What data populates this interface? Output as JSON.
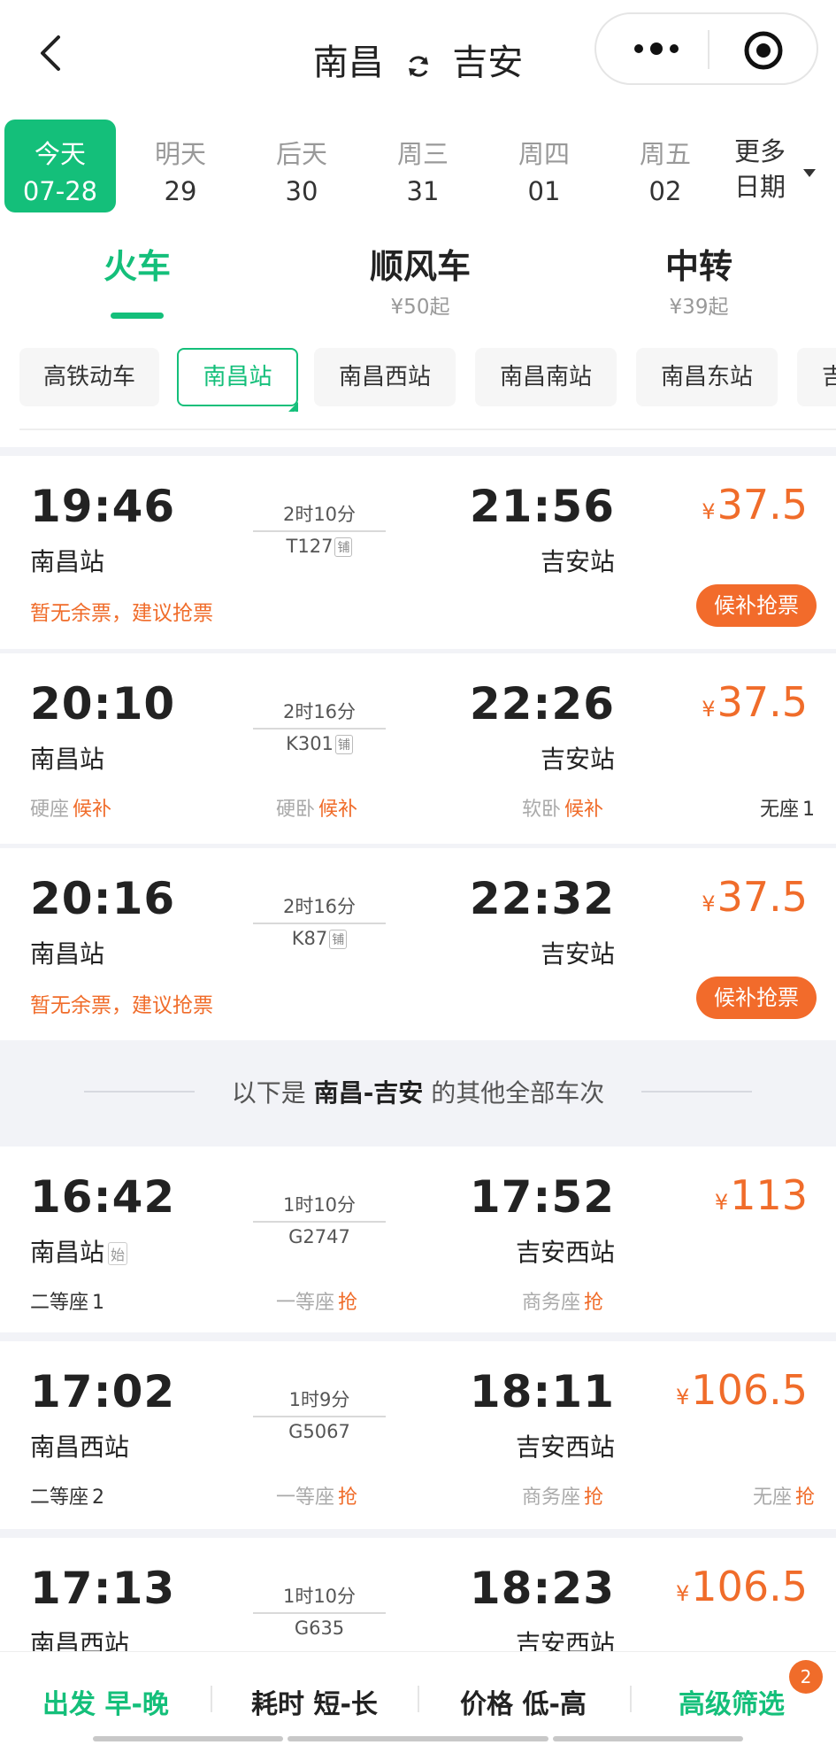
{
  "header": {
    "from": "南昌",
    "to": "吉安"
  },
  "dates": {
    "items": [
      {
        "weekday": "今天",
        "day": "07-28"
      },
      {
        "weekday": "明天",
        "day": "29"
      },
      {
        "weekday": "后天",
        "day": "30"
      },
      {
        "weekday": "周三",
        "day": "31"
      },
      {
        "weekday": "周四",
        "day": "01"
      },
      {
        "weekday": "周五",
        "day": "02"
      }
    ],
    "more_line1": "更多",
    "more_line2": "日期"
  },
  "modes": [
    {
      "label": "火车",
      "sub": ""
    },
    {
      "label": "顺风车",
      "sub": "¥50起"
    },
    {
      "label": "中转",
      "sub": "¥39起"
    }
  ],
  "chips": [
    "高铁动车",
    "南昌站",
    "南昌西站",
    "南昌南站",
    "南昌东站",
    "吉"
  ],
  "trains": [
    {
      "dep_time": "19:46",
      "dep_station": "南昌站",
      "duration": "2时10分",
      "number": "T127",
      "tag": "铺",
      "arr_time": "21:56",
      "arr_station": "吉安站",
      "price": "37.5",
      "warn": "暂无余票，建议抢票",
      "button": "候补抢票"
    },
    {
      "dep_time": "20:10",
      "dep_station": "南昌站",
      "duration": "2时16分",
      "number": "K301",
      "tag": "铺",
      "arr_time": "22:26",
      "arr_station": "吉安站",
      "price": "37.5",
      "seats": [
        {
          "name": "硬座",
          "value": "候补"
        },
        {
          "name": "硬卧",
          "value": "候补"
        },
        {
          "name": "软卧",
          "value": "候补"
        },
        {
          "name": "无座",
          "value": "1"
        }
      ]
    },
    {
      "dep_time": "20:16",
      "dep_station": "南昌站",
      "duration": "2时16分",
      "number": "K87",
      "tag": "铺",
      "arr_time": "22:32",
      "arr_station": "吉安站",
      "price": "37.5",
      "warn": "暂无余票，建议抢票",
      "button": "候补抢票"
    }
  ],
  "divider": {
    "prefix": "以下是",
    "route": "南昌-吉安",
    "suffix": "的其他全部车次"
  },
  "other_trains": [
    {
      "dep_time": "16:42",
      "dep_station": "南昌站",
      "start_tag": "始",
      "duration": "1时10分",
      "number": "G2747",
      "arr_time": "17:52",
      "arr_station": "吉安西站",
      "price": "113",
      "seats": [
        {
          "name": "二等座",
          "value": "1"
        },
        {
          "name": "一等座",
          "value": "抢"
        },
        {
          "name": "商务座",
          "value": "抢"
        }
      ]
    },
    {
      "dep_time": "17:02",
      "dep_station": "南昌西站",
      "duration": "1时9分",
      "number": "G5067",
      "arr_time": "18:11",
      "arr_station": "吉安西站",
      "price": "106.5",
      "seats": [
        {
          "name": "二等座",
          "value": "2"
        },
        {
          "name": "一等座",
          "value": "抢"
        },
        {
          "name": "商务座",
          "value": "抢"
        },
        {
          "name": "无座",
          "value": "抢"
        }
      ]
    },
    {
      "dep_time": "17:13",
      "dep_station": "南昌西站",
      "duration": "1时10分",
      "number": "G635",
      "arr_time": "18:23",
      "arr_station": "吉安西站",
      "price": "106.5"
    }
  ],
  "yen": "¥",
  "bottom": {
    "sort1": "出发 早-晚",
    "sort2": "耗时 短-长",
    "sort3": "价格 低-高",
    "filter": "高级筛选",
    "badge": "2"
  },
  "colors": {
    "accent_green": "#14bf7a",
    "price_orange": "#f06c2a"
  }
}
